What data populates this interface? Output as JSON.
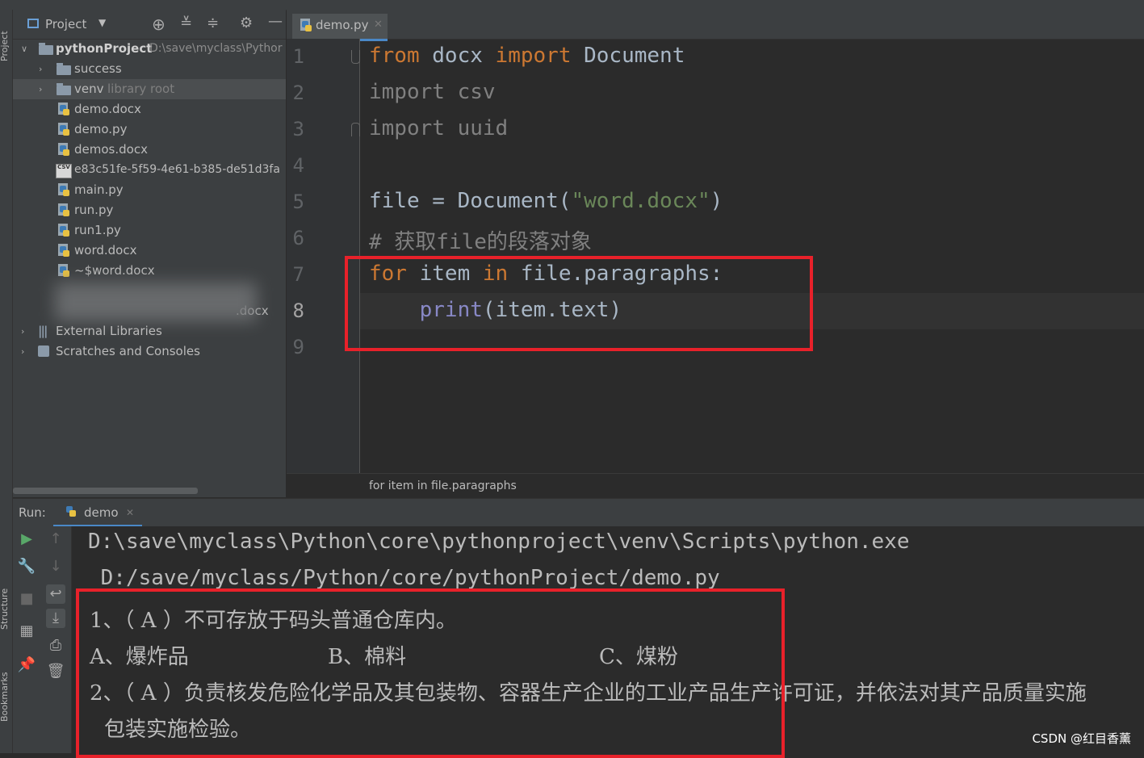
{
  "left_strip": {
    "project_label": "Project",
    "structure_label": "Structure",
    "bookmarks_label": "Bookmarks"
  },
  "project_panel": {
    "title": "Project",
    "root": {
      "name": "pythonProject",
      "path": "D:\\save\\myclass\\Pythor"
    },
    "items": [
      {
        "name": "success",
        "kind": "folder"
      },
      {
        "name": "venv",
        "extra": "library root",
        "kind": "folder"
      },
      {
        "name": "demo.docx",
        "kind": "file"
      },
      {
        "name": "demo.py",
        "kind": "file"
      },
      {
        "name": "demos.docx",
        "kind": "file"
      },
      {
        "name": "e83c51fe-5f59-4e61-b385-de51d3fa",
        "kind": "csv"
      },
      {
        "name": "main.py",
        "kind": "file"
      },
      {
        "name": "run.py",
        "kind": "file"
      },
      {
        "name": "run1.py",
        "kind": "file"
      },
      {
        "name": "word.docx",
        "kind": "file"
      },
      {
        "name": "~$word.docx",
        "kind": "file"
      },
      {
        "name": ".docx",
        "kind": "file"
      }
    ],
    "external_libraries": "External Libraries",
    "scratches": "Scratches and Consoles",
    "csv_badge": "CSV"
  },
  "editor": {
    "tab_label": "demo.py",
    "line_numbers": [
      "1",
      "2",
      "3",
      "4",
      "5",
      "6",
      "7",
      "8",
      "9"
    ],
    "code": {
      "l1_kw1": "from",
      "l1_mod": " docx ",
      "l1_kw2": "import",
      "l1_name": " Document",
      "l2": "import csv",
      "l3": "import uuid",
      "l5_a": "file = Document(",
      "l5_str": "\"word.docx\"",
      "l5_b": ")",
      "l6": "# 获取file的段落对象",
      "l7_kw1": "for",
      "l7_a": " item ",
      "l7_kw2": "in",
      "l7_b": " file.paragraphs:",
      "l8_indent": "    ",
      "l8_fn": "print",
      "l8_a": "(item.text)"
    },
    "breadcrumb": "for item in file.paragraphs"
  },
  "run_panel": {
    "run_label": "Run:",
    "tab_label": "demo",
    "console": {
      "cmd_line1": "D:\\save\\myclass\\Python\\core\\pythonproject\\venv\\Scripts\\python.exe",
      "cmd_line2": " D:/save/myclass/Python/core/pythonProject/demo.py",
      "q1": "1、（ A ）不可存放于码头普通仓库内。",
      "q1_a": "A、爆炸品",
      "q1_b": "B、棉料",
      "q1_c": "C、煤粉",
      "q2": "2、（ A ）负责核发危险化学品及其包装物、容器生产企业的工业产品生产许可证，并依法对其产品质量实施",
      "q2_cont": "包装实施检验。"
    }
  },
  "watermark": "CSDN @红目香薰",
  "colors": {
    "highlight_box": "#e8212a",
    "keyword": "#cc7832",
    "string": "#6a8759",
    "builtin": "#8888c6"
  }
}
